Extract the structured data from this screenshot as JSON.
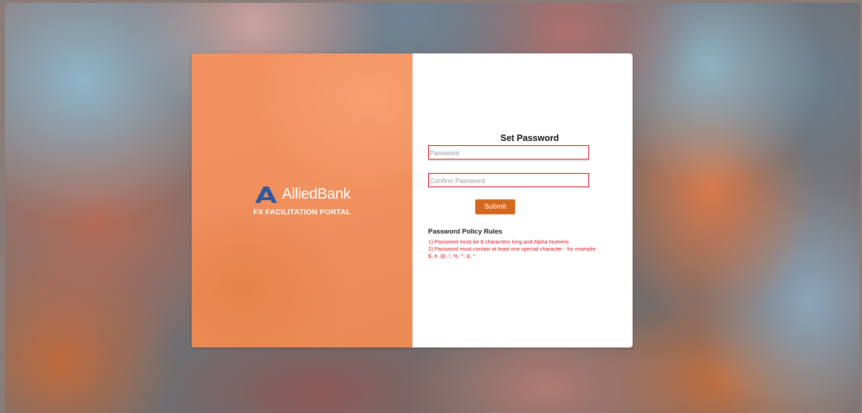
{
  "brand": {
    "name": "AlliedBank",
    "tagline": "FX FACILITATION PORTAL",
    "logo_color": "#2c5aa0"
  },
  "form": {
    "title": "Set Password",
    "password_placeholder": "Password",
    "password_value": "",
    "confirm_placeholder": "Confirm Password",
    "confirm_value": "",
    "submit_label": "Submit"
  },
  "policy": {
    "heading": "Password Policy Rules",
    "rules": [
      "1) Password must be 8 characters long and Alpha Numeric",
      "2) Password must contain at least one special character - for example: $, #, @, !, %, ^, &, *"
    ]
  },
  "colors": {
    "panel_orange": "#f0905e",
    "button": "#d5681f",
    "error_red": "#e0131e"
  }
}
